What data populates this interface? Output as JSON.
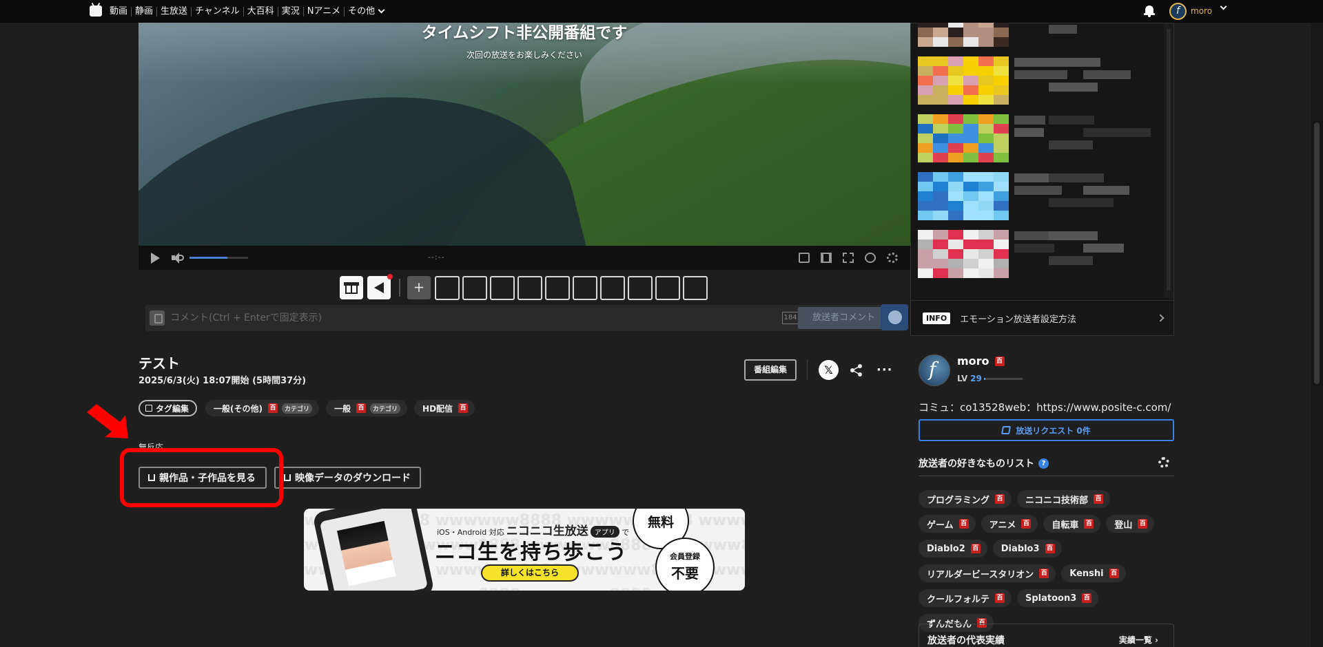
{
  "topbar": {
    "nav_items": [
      "動画",
      "静画",
      "生放送",
      "チャンネル",
      "大百科",
      "実況",
      "Nアニメ",
      "その他"
    ],
    "user_name": "moro",
    "avatar_letter": "f"
  },
  "player": {
    "overlay_title": "タイムシフト非公開番組です",
    "overlay_subtitle": "次回の放送をお楽しみください",
    "timecode": "--:--",
    "volume_level": 0.65
  },
  "comment": {
    "placeholder": "コメント(Ctrl + Enterで固定表示)",
    "id_badge": "184",
    "submit_label": "放送者コメント"
  },
  "sidepanel": {
    "info_badge": "INFO",
    "info_text": "エモーション放送者設定方法"
  },
  "program": {
    "title": "テスト",
    "date": "2025/6/3(火) 18:07開始 (5時間37分)",
    "edit_label": "番組編集",
    "x_label": "𝕏",
    "more_label": "···",
    "tag_edit_label": "タグ編集",
    "tags": [
      {
        "label": "一般(その他)",
        "category": "カテゴリ"
      },
      {
        "label": "一般",
        "category": "カテゴリ"
      },
      {
        "label": "HD配信",
        "category": ""
      }
    ],
    "dic_label": "百",
    "reaction_text": "無反応",
    "parent_button": "親作品・子作品を見る",
    "download_button": "映像データのダウンロード"
  },
  "banner": {
    "platform_text": "iOS・Android 対応",
    "brand_text": "ニコニコ生放送",
    "app_badge": "アプリ",
    "de_text": "で",
    "main_text": "ニコ生を持ち歩こう",
    "cta_text": "詳しくはこちら",
    "free_text": "無料",
    "reg_line1": "会員登録",
    "reg_line2": "不要",
    "watermark": "wwwwww8888"
  },
  "broadcaster": {
    "name": "moro",
    "level_label": "LV",
    "level": "29",
    "level_progress": 0.04,
    "community": "コミュ：co13528web：https://www.posite-c.com/",
    "request_label": "放送リクエスト 0件",
    "likes_title": "放送者の好きなものリスト",
    "help_label": "?",
    "likes": [
      "プログラミング",
      "ニコニコ技術部",
      "ゲーム",
      "アニメ",
      "自転車",
      "登山",
      "Diablo2",
      "Diablo3",
      "リアルダービースタリオン",
      "Kenshi",
      "クールフォルテ",
      "Splatoon3",
      "ずんだもん"
    ],
    "achievements_title": "放送者の代表実績",
    "achievements_link": "実績一覧 ›"
  },
  "colors": {
    "accent_blue": "#3b82e0",
    "annotation_red": "#ff0000",
    "dic_red": "#c8201f",
    "user_gold": "#e0b64a"
  }
}
